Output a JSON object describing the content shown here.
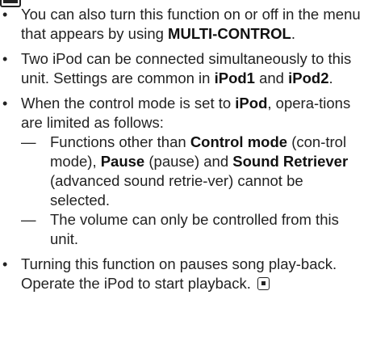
{
  "notes": {
    "item1": {
      "text": "You can also turn this function on or off in the menu that appears by using",
      "bold": "MULTI-CONTROL",
      "tail": "."
    },
    "item2": {
      "text": "Two iPod can be connected simultaneously to this unit. Settings are common in",
      "bold1": "iPod1",
      "mid": "and",
      "bold2": "iPod2",
      "tail": "."
    },
    "item3": {
      "text1": "When the control mode is set to",
      "bold": "iPod",
      "text2": ", opera-tions are limited as follows:",
      "sub1": {
        "dash": "—",
        "text1": "Functions other than",
        "bold1": "Control mode",
        "text2": "(con-trol mode),",
        "bold2": "Pause",
        "text3": "(pause) and",
        "bold3": "Sound Retriever",
        "text4": "(advanced sound retrie-ver) cannot be selected."
      },
      "sub2": {
        "dash": "—",
        "text": "The volume can only be controlled from this unit."
      }
    },
    "item4": {
      "text": "Turning this function on pauses song play-back. Operate the iPod to start playback."
    },
    "bullet": "•"
  },
  "icons": {
    "top_mark": "end-of-section-mark-icon",
    "end_mark": "end-of-section-mark-icon"
  }
}
